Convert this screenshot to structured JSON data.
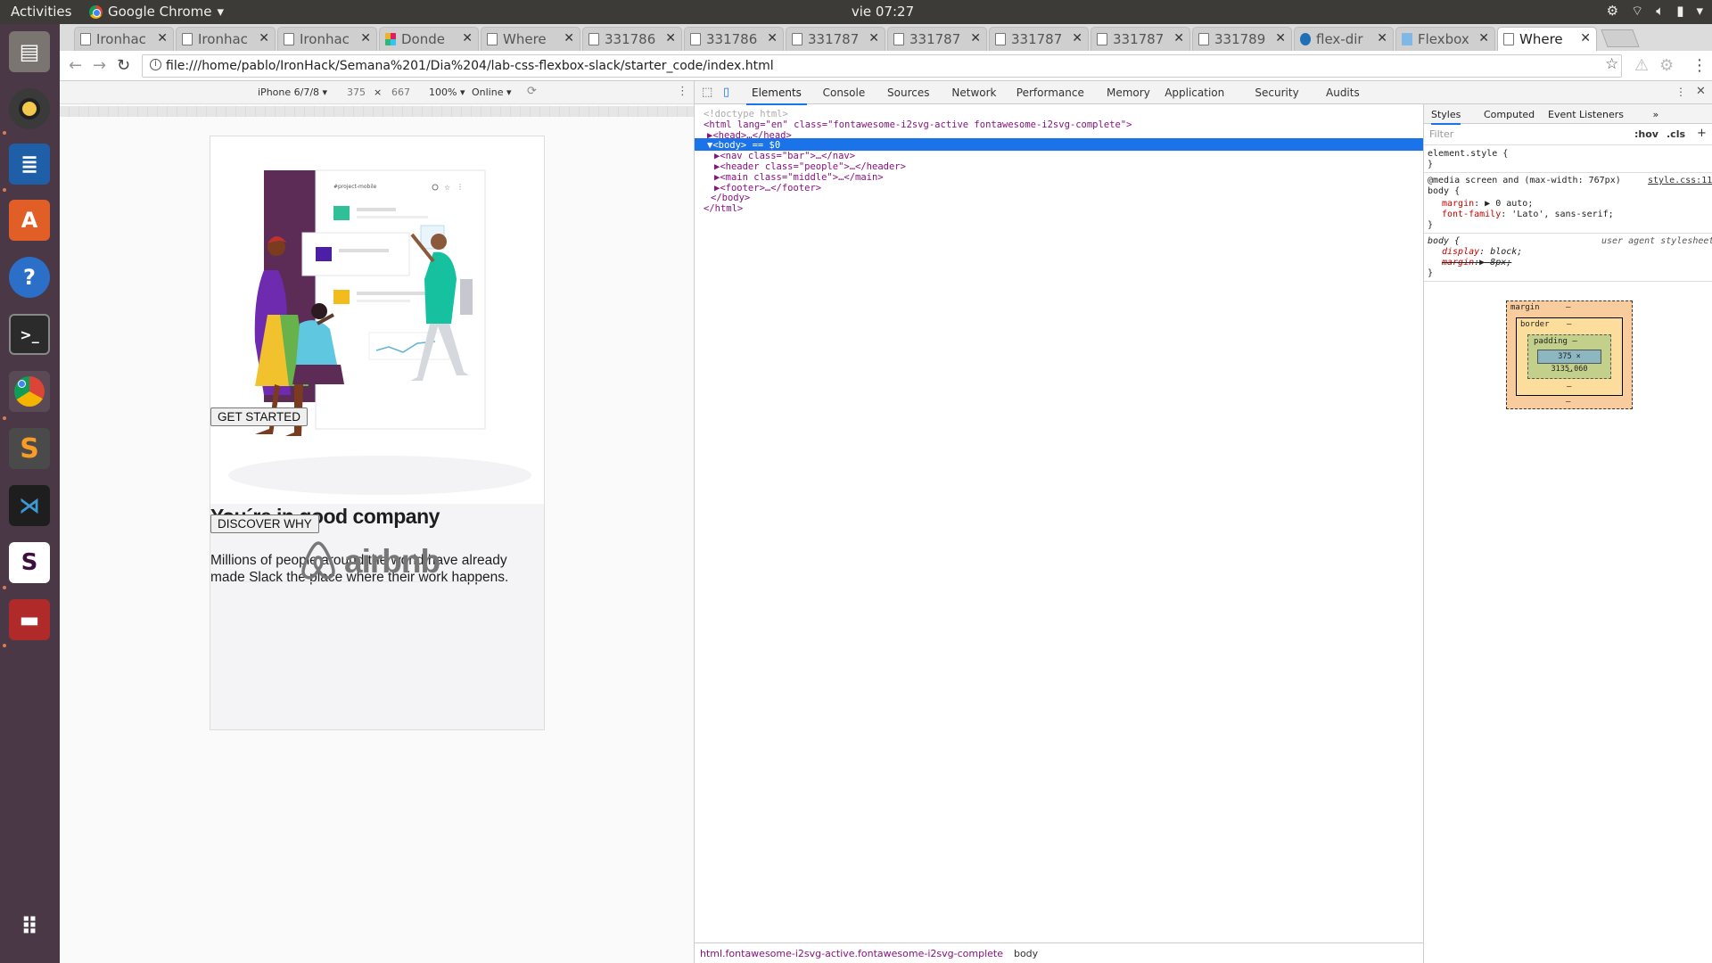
{
  "system": {
    "activities": "Activities",
    "app": "Google Chrome",
    "clock": "vie 07:27"
  },
  "tabs": [
    {
      "label": "Ironhac",
      "icon": "page-icon"
    },
    {
      "label": "Ironhac",
      "icon": "page-icon"
    },
    {
      "label": "Ironhac",
      "icon": "page-icon"
    },
    {
      "label": "Donde",
      "icon": "slack-icon"
    },
    {
      "label": "Where",
      "icon": "page-icon"
    },
    {
      "label": "331786",
      "icon": "page-icon"
    },
    {
      "label": "331786",
      "icon": "page-icon"
    },
    {
      "label": "331787",
      "icon": "page-icon"
    },
    {
      "label": "331787",
      "icon": "page-icon"
    },
    {
      "label": "331787",
      "icon": "page-icon"
    },
    {
      "label": "331787",
      "icon": "page-icon"
    },
    {
      "label": "331789",
      "icon": "page-icon"
    },
    {
      "label": "flex-dir",
      "icon": "css-icon"
    },
    {
      "label": "Flexbox",
      "icon": "flexbox-icon"
    },
    {
      "label": "Where",
      "icon": "page-icon",
      "active": true
    }
  ],
  "address": {
    "url": "file:///home/pablo/IronHack/Semana%201/Dia%204/lab-css-flexbox-slack/starter_code/index.html"
  },
  "device_toolbar": {
    "device": "iPhone 6/7/8 ▾",
    "width": "375",
    "x": "×",
    "height": "667",
    "zoom": "100% ▾",
    "network": "Online ▾"
  },
  "page": {
    "button1": "GET STARTED",
    "heading": "You´re in good company",
    "paragraph": "Millions of people around the world have already made Slack the place where their work happens.",
    "button2": "DISCOVER WHY",
    "logo": "airbnb",
    "illustration_label": "#project-mobile"
  },
  "devtools": {
    "tabs": [
      "Elements",
      "Console",
      "Sources",
      "Network",
      "Performance",
      "Memory",
      "Application",
      "Security",
      "Audits"
    ],
    "dom": [
      {
        "text": "<!doctype html>",
        "cls": "cmt"
      },
      {
        "text": "<html lang=\"en\" class=\"fontawesome-i2svg-active fontawesome-i2svg-complete\">"
      },
      {
        "text": "▶<head>…</head>"
      },
      {
        "text": "▼<body> == $0",
        "selected": true
      },
      {
        "text": "▶<nav class=\"bar\">…</nav>"
      },
      {
        "text": "▶<header class=\"people\">…</header>"
      },
      {
        "text": "▶<main class=\"middle\">…</main>"
      },
      {
        "text": "▶<footer>…</footer>"
      },
      {
        "text": "</body>"
      },
      {
        "text": "</html>"
      }
    ],
    "breadcrumb": "html.fontawesome-i2svg-active.fontawesome-i2svg-complete",
    "breadcrumb2": "body",
    "styles_tabs": [
      "Styles",
      "Computed",
      "Event Listeners",
      "»"
    ],
    "filter_placeholder": "Filter",
    "hov": ":hov",
    "cls": ".cls",
    "plus": "+",
    "element_style": "element.style {",
    "brace_close": "}",
    "media": "@media screen and (max-width: 767px)",
    "media_source": "style.css:11",
    "body_rule": "body {",
    "margin_prop": "margin",
    "margin_val": ": ▶ 0 auto;",
    "font_prop": "font-family",
    "font_val": ": 'Lato', sans-serif;",
    "ua_source": "user agent stylesheet",
    "display_prop": "display",
    "display_val": ": block;",
    "margin8_prop": "margin",
    "margin8_val": ":▶ 8px;",
    "box": {
      "margin": "margin",
      "border": "border",
      "padding": "padding –",
      "content": "375 × 3135.060",
      "dash": "–"
    }
  }
}
